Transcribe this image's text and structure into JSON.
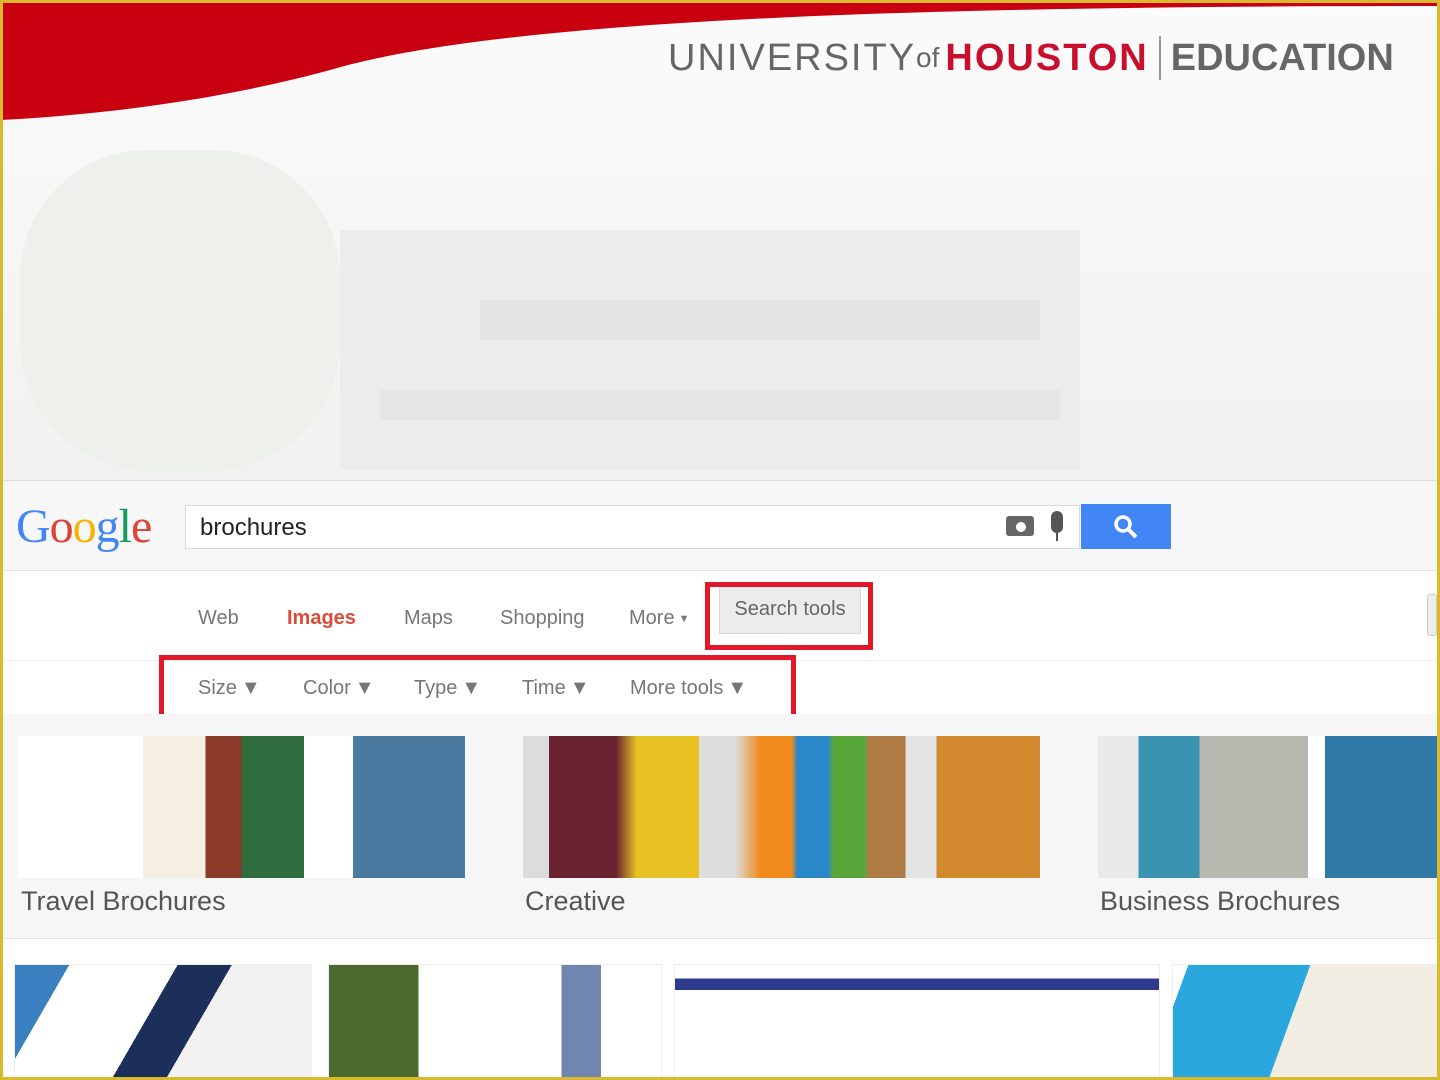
{
  "header": {
    "university": "UNIVERSITY",
    "of": "of",
    "houston": "HOUSTON",
    "college": "EDUCATION",
    "brand_red": "#c8102e",
    "border_gold": "#d9b92e"
  },
  "google": {
    "logo": "Google",
    "search_value": "brochures",
    "icons": [
      "camera-icon",
      "microphone-icon",
      "search-icon"
    ],
    "accent": "#4285f4",
    "nav": [
      {
        "label": "Web"
      },
      {
        "label": "Images",
        "active": true
      },
      {
        "label": "Maps"
      },
      {
        "label": "Shopping"
      },
      {
        "label": "More"
      }
    ],
    "search_tools": "Search tools",
    "tools": [
      {
        "label": "Size"
      },
      {
        "label": "Color"
      },
      {
        "label": "Type"
      },
      {
        "label": "Time"
      },
      {
        "label": "More tools"
      }
    ],
    "categories": [
      {
        "label": "Travel Brochures"
      },
      {
        "label": "Creative"
      },
      {
        "label": "Business Brochures"
      }
    ],
    "highlight_color": "#e0182a"
  }
}
